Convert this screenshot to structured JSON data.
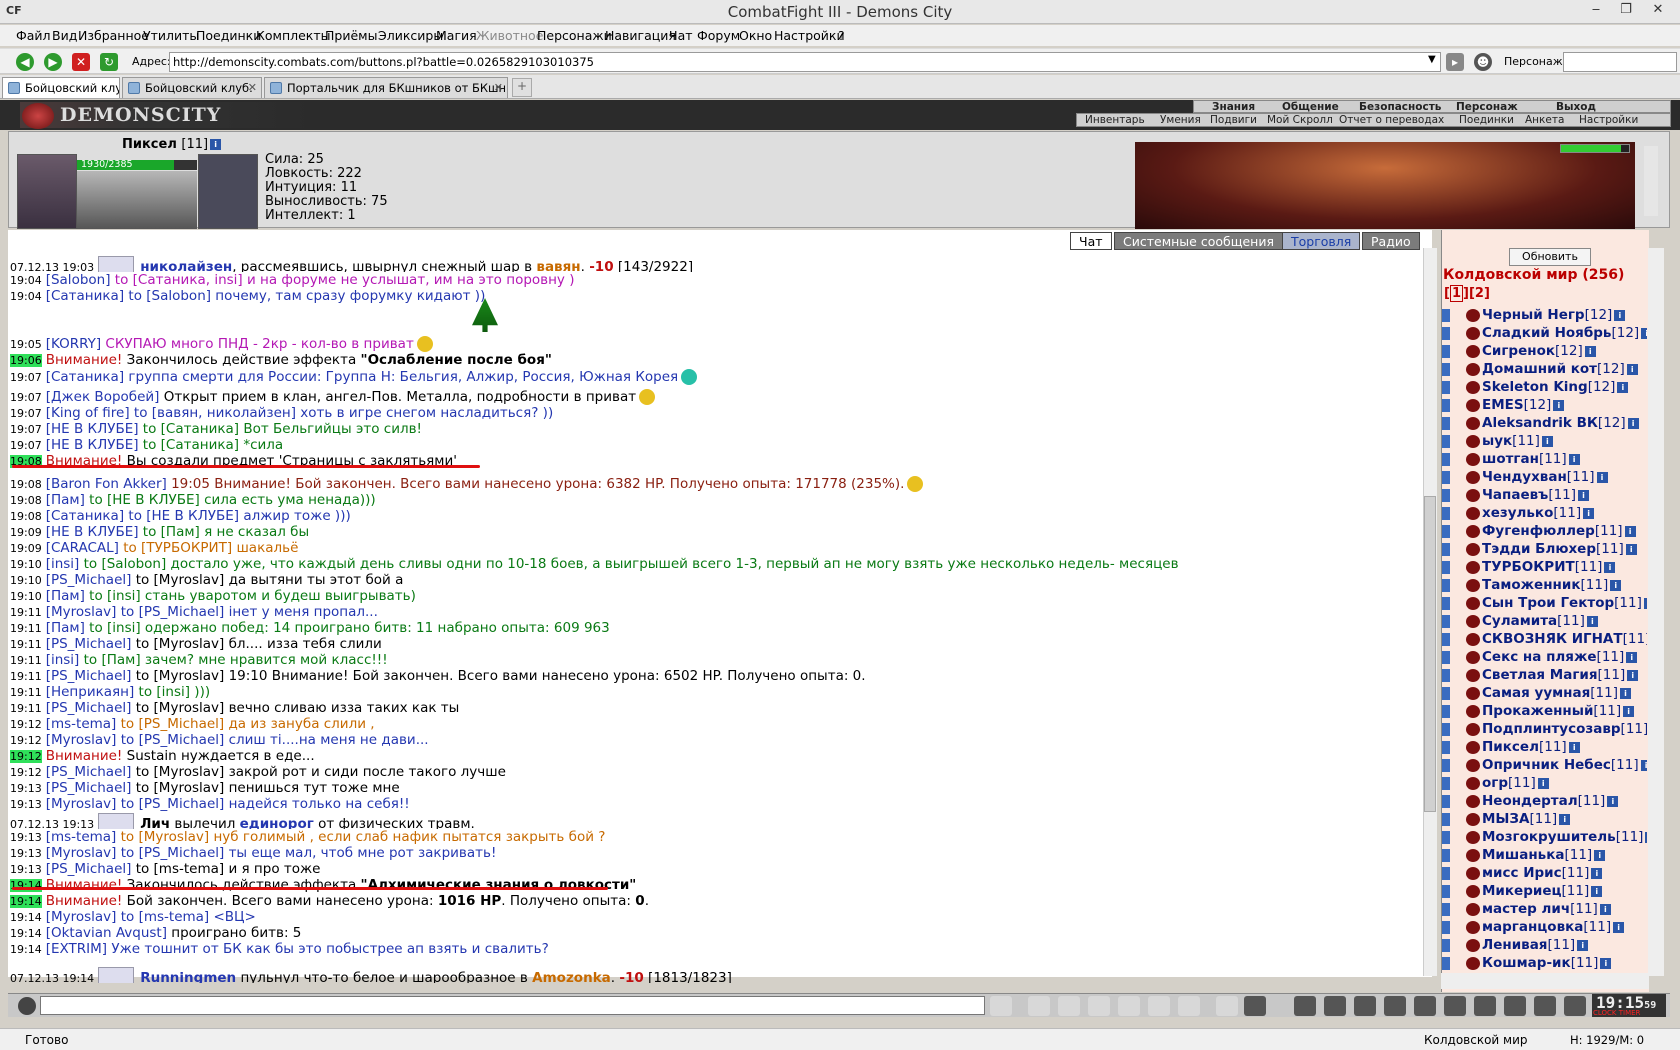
{
  "window": {
    "title": "CombatFight III - Demons City",
    "app_logo": "CF"
  },
  "menu": [
    "Файл",
    "Вид",
    "Избранное",
    "Утилиты",
    "Поединки",
    "Комплекты",
    "Приёмы",
    "Эликсиры",
    "Магия",
    "Животное",
    "Персонажи",
    "Навигация",
    "Чат",
    "Форум",
    "Окно",
    "Настройки",
    "?"
  ],
  "address": {
    "label": "Адрес:",
    "url": "http://demonscity.combats.com/buttons.pl?battle=0.0265829103010375",
    "person_label": "Персонаж:"
  },
  "tabs": [
    "Бойцовский клуб",
    "Бойцовский клуб.",
    "Портальчик для БКшников от БКшни..."
  ],
  "game": {
    "logo": "DEMONSCITY",
    "nav_top": [
      "Знания",
      "Общение",
      "Безопасность",
      "Персонаж",
      "Выход"
    ],
    "nav_bottom": [
      "Инвентарь",
      "Умения",
      "Подвиги",
      "Мой Скролл",
      "Отчет о переводах",
      "Поединки",
      "Анкета",
      "Настройки"
    ]
  },
  "character": {
    "name": "Пиксел",
    "level": "[11]",
    "hp": "1930/2385",
    "hp_fraction": 0.809,
    "stats": [
      "Сила: 25",
      "Ловкость: 222",
      "Интуиция: 11",
      "Выносливость: 75",
      "Интеллект: 1"
    ]
  },
  "chat_tabs": [
    "Чат",
    "Системные сообщения",
    "Торговля",
    "Радио"
  ],
  "chat": [
    {
      "ts": "07.12.13 19:03",
      "parts": [
        {
          "t": "николайзен",
          "c": "c-blue",
          "b": true
        },
        {
          "t": ", рассмеявшись, швырнул снежный шар в ",
          "c": "c-black"
        },
        {
          "t": "вавян",
          "c": "c-orange",
          "b": true
        },
        {
          "t": ". ",
          "c": "c-black"
        },
        {
          "t": "-10",
          "c": "c-red",
          "b": true
        },
        {
          "t": " [143/2922]",
          "c": "c-black"
        }
      ]
    },
    {
      "ts": "19:04",
      "parts": [
        {
          "t": "[Salobon]",
          "c": "c-blue"
        },
        {
          "t": " to [Сатаника, insi] и на форуме не услышат, им на это поровну )",
          "c": "c-magenta"
        }
      ]
    },
    {
      "ts": "19:04",
      "parts": [
        {
          "t": "[Сатаника]",
          "c": "c-blue"
        },
        {
          "t": " to [Salobon] почему, там сразу форумку кидают ))",
          "c": "c-blue"
        }
      ]
    },
    {
      "ts": "19:05",
      "parts": [
        {
          "t": "[KORRY]",
          "c": "c-blue"
        },
        {
          "t": " СКУПАЮ много ПНД - 2кр - кол-во в приват",
          "c": "c-magenta"
        }
      ]
    },
    {
      "ts": "19:06",
      "hl": true,
      "parts": [
        {
          "t": "Внимание!",
          "c": "c-red"
        },
        {
          "t": " Закончилось действие эффекта ",
          "c": "c-black"
        },
        {
          "t": "\"Ослабление после боя\"",
          "c": "c-black",
          "b": true
        }
      ]
    },
    {
      "ts": "19:07",
      "parts": [
        {
          "t": "[Сатаника]",
          "c": "c-blue"
        },
        {
          "t": " группа смерти для России: Группа Н: Бельгия, Алжир, Россия, Южная Корея",
          "c": "c-blue"
        }
      ]
    },
    {
      "ts": "19:07",
      "parts": [
        {
          "t": "[Джек Воробей]",
          "c": "c-blue"
        },
        {
          "t": " Открыт прием в клан, ангел-Пов. Металла, подробности в приват",
          "c": "c-black"
        }
      ]
    },
    {
      "ts": "19:07",
      "parts": [
        {
          "t": "[King of fire]",
          "c": "c-blue"
        },
        {
          "t": " to [вавян, николайзен] хоть в игре снегом насладиться? ))",
          "c": "c-blue"
        }
      ]
    },
    {
      "ts": "19:07",
      "parts": [
        {
          "t": "[НЕ В КЛУБЕ]",
          "c": "c-blue"
        },
        {
          "t": " to [Сатаника] Вот Бельгийцы это силв!",
          "c": "c-green"
        }
      ]
    },
    {
      "ts": "19:07",
      "parts": [
        {
          "t": "[НЕ В КЛУБЕ]",
          "c": "c-blue"
        },
        {
          "t": " to [Сатаника] *сила",
          "c": "c-green"
        }
      ]
    },
    {
      "ts": "19:08",
      "hl": true,
      "parts": [
        {
          "t": "Внимание!",
          "c": "c-red"
        },
        {
          "t": " Вы создали предмет 'Страницы с заклятьями'",
          "c": "c-black"
        }
      ]
    },
    {
      "ts": "19:08",
      "parts": [
        {
          "t": "[Baron Fon Akker]",
          "c": "c-blue"
        },
        {
          "t": " 19:05 Внимание! Бой закончен. Всего вами нанесено урона: 6382 HP. Получено опыта: 171778 (235%).",
          "c": "c-brown"
        }
      ]
    },
    {
      "ts": "19:08",
      "parts": [
        {
          "t": "[Пам]",
          "c": "c-blue"
        },
        {
          "t": " to [НЕ В КЛУБЕ] сила есть ума ненада)))",
          "c": "c-green"
        }
      ]
    },
    {
      "ts": "19:08",
      "parts": [
        {
          "t": "[Сатаника]",
          "c": "c-blue"
        },
        {
          "t": " to [НЕ В КЛУБЕ] алжир тоже )))",
          "c": "c-blue"
        }
      ]
    },
    {
      "ts": "19:09",
      "parts": [
        {
          "t": "[НЕ В КЛУБЕ]",
          "c": "c-blue"
        },
        {
          "t": " to [Пам] я не сказал бы",
          "c": "c-green"
        }
      ]
    },
    {
      "ts": "19:09",
      "parts": [
        {
          "t": "[CARACAL]",
          "c": "c-blue"
        },
        {
          "t": " to [ТУРБОКРИТ] шакальё",
          "c": "c-orange"
        }
      ]
    },
    {
      "ts": "19:10",
      "parts": [
        {
          "t": "[insi]",
          "c": "c-blue"
        },
        {
          "t": " to [Salobon] достало уже, что каждый день сливы одни по 10-18 боев, а выигрышей всего 1-3, первый ап не могу взять уже несколько недель- месяцев",
          "c": "c-green"
        }
      ]
    },
    {
      "ts": "19:10",
      "parts": [
        {
          "t": "[PS_Michael]",
          "c": "c-blue"
        },
        {
          "t": " to [Myroslav] да вытяни ты этот бой а",
          "c": "c-black"
        }
      ]
    },
    {
      "ts": "19:10",
      "parts": [
        {
          "t": "[Пам]",
          "c": "c-blue"
        },
        {
          "t": " to [insi] стань уваротом и будеш выигрывать)",
          "c": "c-green"
        }
      ]
    },
    {
      "ts": "19:11",
      "parts": [
        {
          "t": "[Myroslav]",
          "c": "c-blue"
        },
        {
          "t": " to [PS_Michael] інет у меня пропал...",
          "c": "c-blue"
        }
      ]
    },
    {
      "ts": "19:11",
      "parts": [
        {
          "t": "[Пам]",
          "c": "c-blue"
        },
        {
          "t": " to [insi] одержано побед: 14 проиграно битв: 11 набрано опыта: 609 963",
          "c": "c-green"
        }
      ]
    },
    {
      "ts": "19:11",
      "parts": [
        {
          "t": "[PS_Michael]",
          "c": "c-blue"
        },
        {
          "t": " to [Myroslav] бл.... изза тебя слили",
          "c": "c-black"
        }
      ]
    },
    {
      "ts": "19:11",
      "parts": [
        {
          "t": "[insi]",
          "c": "c-blue"
        },
        {
          "t": " to [Пам] зачем? мне нравится мой класс!!!",
          "c": "c-green"
        }
      ]
    },
    {
      "ts": "19:11",
      "parts": [
        {
          "t": "[PS_Michael]",
          "c": "c-blue"
        },
        {
          "t": " to [Myroslav] 19:10 Внимание! Бой закончен. Всего вами нанесено урона: 6502 HP. Получено опыта: 0.",
          "c": "c-black"
        }
      ]
    },
    {
      "ts": "19:11",
      "parts": [
        {
          "t": "[Неприкаян]",
          "c": "c-blue"
        },
        {
          "t": " to [insi] )))",
          "c": "c-green"
        }
      ]
    },
    {
      "ts": "19:11",
      "parts": [
        {
          "t": "[PS_Michael]",
          "c": "c-blue"
        },
        {
          "t": " to [Myroslav] вечно сливаю изза таких как ты",
          "c": "c-black"
        }
      ]
    },
    {
      "ts": "19:12",
      "parts": [
        {
          "t": "[ms-tema]",
          "c": "c-blue"
        },
        {
          "t": " to [PS_Michael] да из зануба слили ,",
          "c": "c-orange"
        }
      ]
    },
    {
      "ts": "19:12",
      "parts": [
        {
          "t": "[Myroslav]",
          "c": "c-blue"
        },
        {
          "t": " to [PS_Michael] слиш ті....на меня не дави...",
          "c": "c-blue"
        }
      ]
    },
    {
      "ts": "19:12",
      "hl": true,
      "parts": [
        {
          "t": "Внимание!",
          "c": "c-red"
        },
        {
          "t": " Sustain нуждается в еде...",
          "c": "c-black"
        }
      ]
    },
    {
      "ts": "19:12",
      "parts": [
        {
          "t": "[PS_Michael]",
          "c": "c-blue"
        },
        {
          "t": " to [Myroslav] закрой рот и сиди после такого лучше",
          "c": "c-black"
        }
      ]
    },
    {
      "ts": "19:13",
      "parts": [
        {
          "t": "[PS_Michael]",
          "c": "c-blue"
        },
        {
          "t": " to [Myroslav] пенишься тут тоже мне",
          "c": "c-black"
        }
      ]
    },
    {
      "ts": "19:13",
      "parts": [
        {
          "t": "[Myroslav]",
          "c": "c-blue"
        },
        {
          "t": " to [PS_Michael] надейся только на себя!!",
          "c": "c-blue"
        }
      ]
    },
    {
      "ts": "07.12.13 19:13",
      "parts": [
        {
          "t": "Лич",
          "c": "c-black",
          "b": true
        },
        {
          "t": " вылечил ",
          "c": "c-black"
        },
        {
          "t": "единорог",
          "c": "c-blue",
          "b": true
        },
        {
          "t": " от физических травм.",
          "c": "c-black"
        }
      ]
    },
    {
      "ts": "19:13",
      "parts": [
        {
          "t": "[ms-tema]",
          "c": "c-blue"
        },
        {
          "t": " to [Myroslav] нуб голимый , если слаб нафик пытатся закрыть бой ?",
          "c": "c-orange"
        }
      ]
    },
    {
      "ts": "19:13",
      "parts": [
        {
          "t": "[Myroslav]",
          "c": "c-blue"
        },
        {
          "t": " to [PS_Michael] ты еще мал, чтоб мне рот закривать!",
          "c": "c-blue"
        }
      ]
    },
    {
      "ts": "19:13",
      "parts": [
        {
          "t": "[PS_Michael]",
          "c": "c-blue"
        },
        {
          "t": " to [ms-tema] и я про тоже",
          "c": "c-black"
        }
      ]
    },
    {
      "ts": "19:14",
      "hl": true,
      "parts": [
        {
          "t": "Внимание!",
          "c": "c-red"
        },
        {
          "t": " Закончилось действие эффекта ",
          "c": "c-black"
        },
        {
          "t": "\"Алхимические знания о ловкости\"",
          "c": "c-black",
          "b": true
        }
      ]
    },
    {
      "ts": "19:14",
      "hl": true,
      "parts": [
        {
          "t": "Внимание!",
          "c": "c-red"
        },
        {
          "t": " Бой закончен. Всего вами нанесено урона: ",
          "c": "c-black"
        },
        {
          "t": "1016 HP",
          "c": "c-black",
          "b": true
        },
        {
          "t": ". Получено опыта: ",
          "c": "c-black"
        },
        {
          "t": "0",
          "c": "c-black",
          "b": true
        },
        {
          "t": ".",
          "c": "c-black"
        }
      ]
    },
    {
      "ts": "19:14",
      "parts": [
        {
          "t": "[Myroslav]",
          "c": "c-blue"
        },
        {
          "t": " to [ms-tema] <ВЦ>",
          "c": "c-blue"
        }
      ]
    },
    {
      "ts": "19:14",
      "parts": [
        {
          "t": "[Oktavian Avqust]",
          "c": "c-blue"
        },
        {
          "t": " проиграно битв: 5",
          "c": "c-black"
        }
      ]
    },
    {
      "ts": "19:14",
      "parts": [
        {
          "t": "[EXTRIM]",
          "c": "c-blue"
        },
        {
          "t": " Уже тошнит от БК как бы это побыстрее ап взять и свалить?",
          "c": "c-blue"
        }
      ]
    },
    {
      "ts": "07.12.13 19:14",
      "parts": [
        {
          "t": "Runningmen",
          "c": "c-blue",
          "b": true
        },
        {
          "t": " пульнул что-то белое и шарообразное в ",
          "c": "c-black"
        },
        {
          "t": "Amozonka",
          "c": "c-orange",
          "b": true
        },
        {
          "t": ". ",
          "c": "c-black"
        },
        {
          "t": "-10",
          "c": "c-red",
          "b": true
        },
        {
          "t": " [1813/1823]",
          "c": "c-black"
        }
      ]
    }
  ],
  "room": {
    "refresh": "Обновить",
    "title": "Колдовской мир (256)",
    "pages": [
      "1",
      "2"
    ],
    "players": [
      {
        "n": "Черный Негр",
        "l": "[12]"
      },
      {
        "n": "Сладкий Ноябрь",
        "l": "[12]"
      },
      {
        "n": "Сигренок",
        "l": "[12]"
      },
      {
        "n": "Домашний кот",
        "l": "[12]"
      },
      {
        "n": "Skeleton King",
        "l": "[12]"
      },
      {
        "n": "EMES",
        "l": "[12]"
      },
      {
        "n": "Aleksandrik ВК",
        "l": "[12]"
      },
      {
        "n": "ыук",
        "l": "[11]"
      },
      {
        "n": "шотган",
        "l": "[11]"
      },
      {
        "n": "Чендухван",
        "l": "[11]"
      },
      {
        "n": "Чапаевъ",
        "l": "[11]"
      },
      {
        "n": "хезулько",
        "l": "[11]"
      },
      {
        "n": "Фугенфюллер",
        "l": "[11]"
      },
      {
        "n": "Тэдди Блюхер",
        "l": "[11]"
      },
      {
        "n": "ТУРБОКРИТ",
        "l": "[11]"
      },
      {
        "n": "Таможенник",
        "l": "[11]"
      },
      {
        "n": "Сын Трои Гектор",
        "l": "[11]"
      },
      {
        "n": "Суламита",
        "l": "[11]"
      },
      {
        "n": "СКВОЗНЯК ИГНАТ",
        "l": "[11]"
      },
      {
        "n": "Секс на пляже",
        "l": "[11]"
      },
      {
        "n": "Светлая Магия",
        "l": "[11]"
      },
      {
        "n": "Самая уумная",
        "l": "[11]"
      },
      {
        "n": "Прокаженный",
        "l": "[11]"
      },
      {
        "n": "Подплинтусозавр",
        "l": "[11]"
      },
      {
        "n": "Пиксел",
        "l": "[11]"
      },
      {
        "n": "Опричник Небес",
        "l": "[11]"
      },
      {
        "n": "огр",
        "l": "[11]"
      },
      {
        "n": "Неондертал",
        "l": "[11]"
      },
      {
        "n": "МЫЗА",
        "l": "[11]"
      },
      {
        "n": "Мозгокрушитель",
        "l": "[11]"
      },
      {
        "n": "Мишанька",
        "l": "[11]"
      },
      {
        "n": "мисс Ирис",
        "l": "[11]"
      },
      {
        "n": "Микериец",
        "l": "[11]"
      },
      {
        "n": "мастер лич",
        "l": "[11]"
      },
      {
        "n": "марганцовка",
        "l": "[11]"
      },
      {
        "n": "Ленивая",
        "l": "[11]"
      },
      {
        "n": "Кошмар-ик",
        "l": "[11]"
      }
    ]
  },
  "clock": {
    "time": "19:15",
    "sec": "59",
    "label": "CLOCK TIMER"
  },
  "status": {
    "text": "Готово",
    "location": "Колдовской мир",
    "hp": "H: 1929/M: 0"
  },
  "colors": {
    "hp_bar": "#1aa72a",
    "highlight_ts": "#2fe05a",
    "attention": "#c01010",
    "room_title": "#b00000"
  }
}
